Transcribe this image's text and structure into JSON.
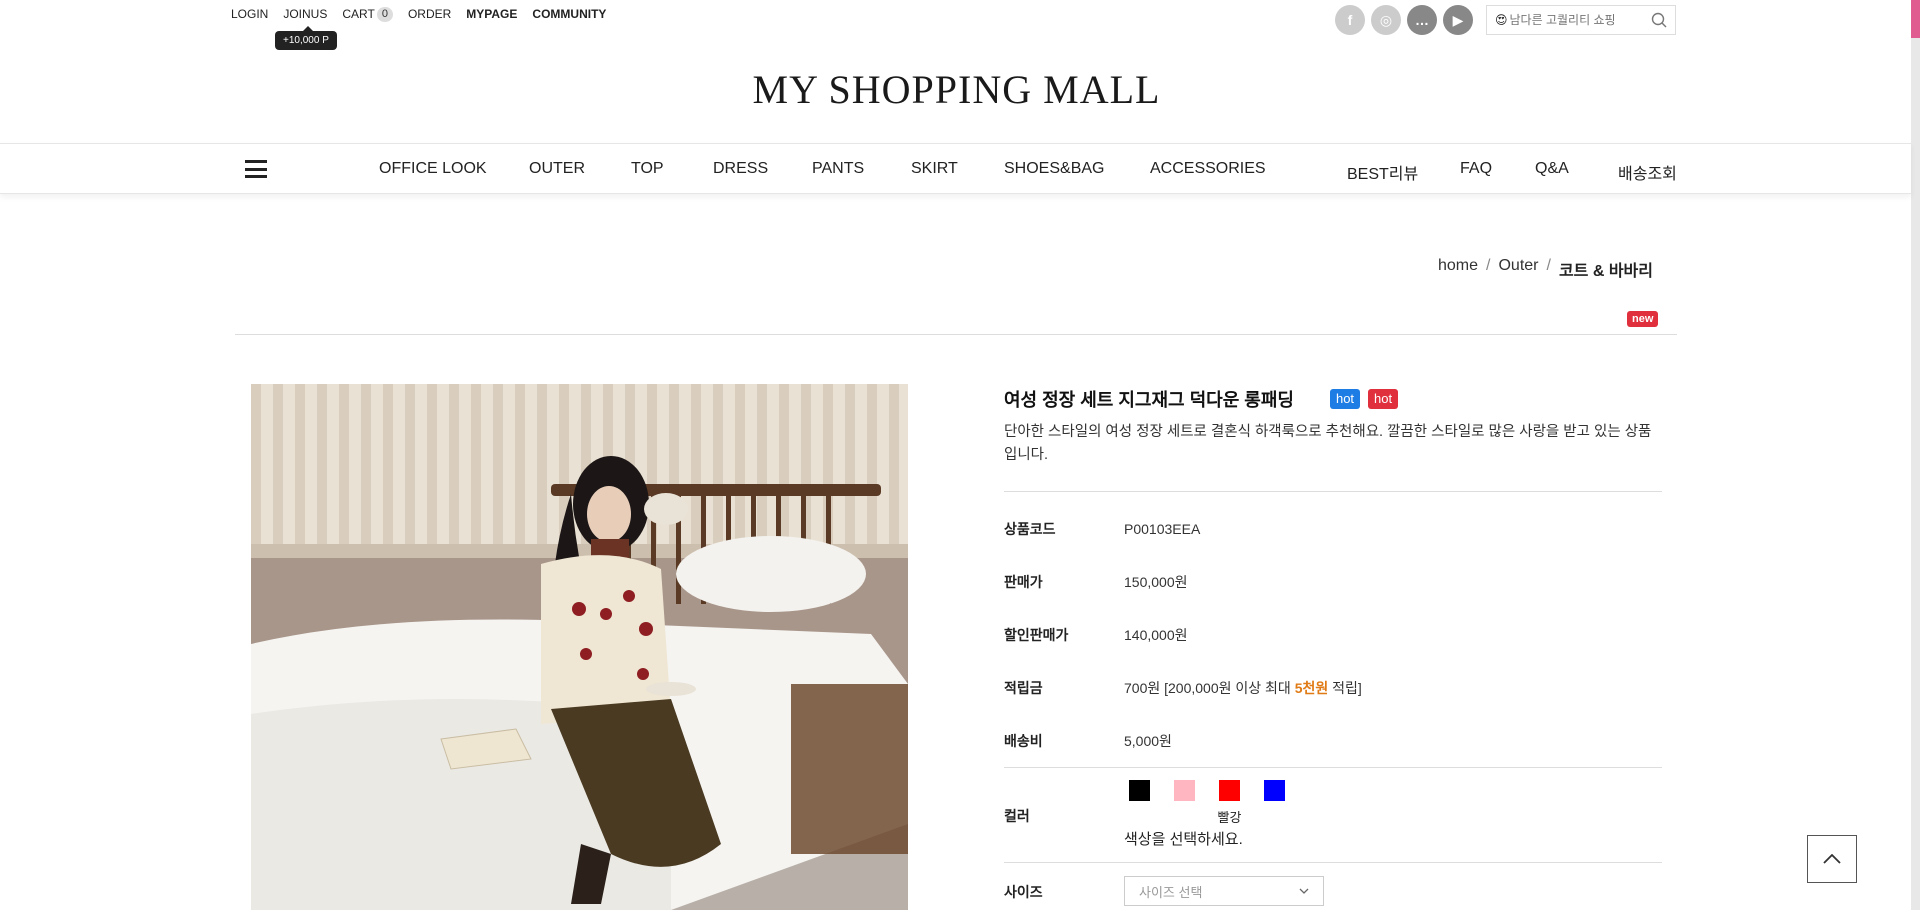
{
  "topbar": {
    "links": [
      "LOGIN",
      "JOINUS",
      "CART",
      "ORDER",
      "MYPAGE",
      "COMMUNITY"
    ],
    "cart_count": "0",
    "join_point_tip": "+10,000 P"
  },
  "social": {
    "icons": [
      "facebook-icon",
      "instagram-icon",
      "chat-icon",
      "youtube-icon"
    ],
    "glyphs": [
      "f",
      "◎",
      "…",
      "▶"
    ]
  },
  "search": {
    "emoji": "😍",
    "placeholder": "남다른 고퀄리티 쇼핑"
  },
  "logo": "MY SHOPPING MALL",
  "nav": {
    "categories": [
      "OFFICE LOOK",
      "OUTER",
      "TOP",
      "DRESS",
      "PANTS",
      "SKIRT",
      "SHOES&BAG",
      "ACCESSORIES"
    ],
    "extras": [
      "BEST리뷰",
      "FAQ",
      "Q&A",
      "배송조회"
    ]
  },
  "breadcrumb": {
    "home": "home",
    "sep": "/",
    "category": "Outer",
    "current": "코트 & 바바리"
  },
  "badges": {
    "new": "new",
    "hot": "hot"
  },
  "product": {
    "title": "여성 정장 세트 지그재그 덕다운 롱패딩",
    "description": "단아한 스타일의 여성 정장 세트로 결혼식 하객룩으로 추천해요. 깔끔한 스타일로 많은 사랑을 받고 있는 상품입니다.",
    "rows": [
      {
        "label": "상품코드",
        "value": "P00103EEA"
      },
      {
        "label": "판매가",
        "value": "150,000원"
      },
      {
        "label": "할인판매가",
        "value": "140,000원"
      }
    ],
    "mileage": {
      "label": "적립금",
      "prefix": "700원 [200,000원 이상 최대 ",
      "highlight": "5천원",
      "suffix": " 적립]"
    },
    "shipping": {
      "label": "배송비",
      "value": "5,000원"
    },
    "color": {
      "label": "컬러",
      "swatches": [
        "#000000",
        "#ffb6c1",
        "#ff0000",
        "#0000ff"
      ],
      "hovered_label": "빨강",
      "help": "색상을 선택하세요."
    },
    "size": {
      "label": "사이즈",
      "placeholder": "사이즈 선택"
    }
  },
  "accent_colors": {
    "hot_blue": "#1e7de4",
    "hot_red": "#e02f3d",
    "mileage_orange": "#e07a14",
    "edge_pink": "#e05c90"
  }
}
